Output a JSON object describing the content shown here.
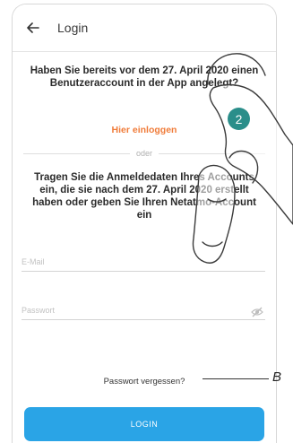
{
  "header": {
    "title": "Login",
    "back_icon": "arrow-left-icon"
  },
  "main": {
    "question_1": "Haben Sie bereits vor dem 27. April 2020 einen Benutzeraccount in der App angelegt?",
    "login_here_link": "Hier einloggen",
    "divider_text": "oder",
    "question_2": "Tragen Sie die Anmeldedaten Ihres Accounts ein, die sie nach dem 27. April 2020 erstellt haben oder geben Sie Ihren Netatmo-Account ein",
    "email_placeholder": "E-Mail",
    "password_placeholder": "Passwort",
    "password_toggle_icon": "eye-off-icon",
    "forgot_password": "Passwort vergessen?",
    "login_button": "LOGIN"
  },
  "annotations": {
    "step_badge": "2",
    "callout_label": "B"
  },
  "colors": {
    "accent": "#2aa4e6",
    "link": "#f07c3a",
    "badge": "#2a8e8a"
  }
}
